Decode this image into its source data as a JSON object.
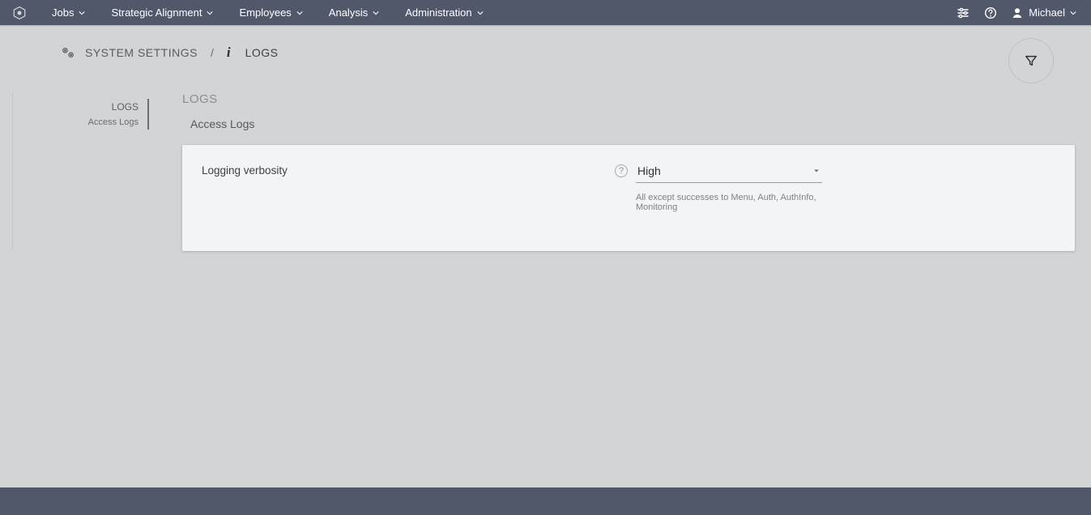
{
  "nav": {
    "items": [
      "Jobs",
      "Strategic Alignment",
      "Employees",
      "Analysis",
      "Administration"
    ],
    "user": "Michael"
  },
  "breadcrumb": {
    "root": "SYSTEM SETTINGS",
    "current": "LOGS"
  },
  "sidebar": {
    "items": [
      {
        "label": "LOGS"
      },
      {
        "label": "Access Logs"
      }
    ]
  },
  "main": {
    "section_title": "LOGS",
    "subsection_title": "Access Logs",
    "form": {
      "label": "Logging verbosity",
      "value": "High",
      "hint": "All except successes to Menu, Auth, AuthInfo, Monitoring"
    }
  }
}
